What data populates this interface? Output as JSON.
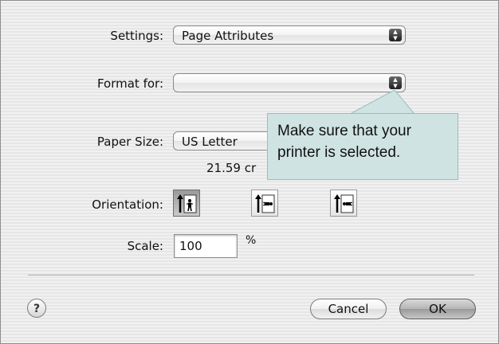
{
  "settings": {
    "label": "Settings:",
    "value": "Page Attributes"
  },
  "format_for": {
    "label": "Format for:",
    "value": ""
  },
  "paper_size": {
    "label": "Paper Size:",
    "value": "US Letter",
    "dimensions_visible": "21.59 cr"
  },
  "orientation": {
    "label": "Orientation:",
    "options": [
      "portrait",
      "landscape",
      "landscape-reverse"
    ],
    "selected": "portrait"
  },
  "scale": {
    "label": "Scale:",
    "value": "100",
    "unit": "%"
  },
  "buttons": {
    "help": "?",
    "cancel": "Cancel",
    "ok": "OK"
  },
  "callout": {
    "line1": "Make sure that your",
    "line2": "printer is selected."
  },
  "icons": {
    "stepper": "up-down-arrows-icon",
    "help": "question-mark-icon",
    "orientation": "person-on-page-icon"
  }
}
